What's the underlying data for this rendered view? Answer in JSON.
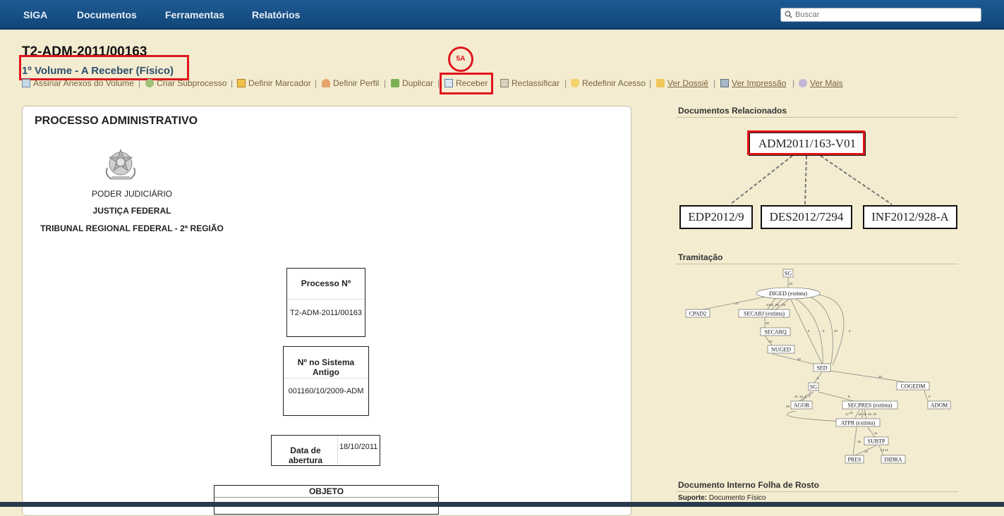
{
  "nav": {
    "items": [
      "SIGA",
      "Documentos",
      "Ferramentas",
      "Relatórios"
    ],
    "search_placeholder": "Buscar"
  },
  "page": {
    "title": "T2-ADM-2011/00163",
    "volume": "1º Volume - A Receber (Físico)",
    "annotation": "5A"
  },
  "actions": [
    {
      "label": "Assinar Anexos do Volume",
      "icon": "sign-icon"
    },
    {
      "label": "Criar Subprocesso",
      "icon": "subprocess-icon"
    },
    {
      "label": "Definir Marcador",
      "icon": "bookmark-icon"
    },
    {
      "label": "Definir Perfil",
      "icon": "profile-icon"
    },
    {
      "label": "Duplicar",
      "icon": "duplicate-icon"
    },
    {
      "label": "Receber",
      "icon": "receive-icon"
    },
    {
      "label": "Reclassificar",
      "icon": "reclassify-icon"
    },
    {
      "label": "Redefinir Acesso",
      "icon": "shield-icon"
    },
    {
      "label": "Ver Dossiê",
      "icon": "folder-icon"
    },
    {
      "label": "Ver Impressão",
      "icon": "printer-icon"
    },
    {
      "label": "Ver Mais",
      "icon": "eye-icon"
    }
  ],
  "document": {
    "heading": "PROCESSO ADMINISTRATIVO",
    "org_line1": "PODER JUDICIÁRIO",
    "org_line2": "JUSTIÇA FEDERAL",
    "org_line3": "TRIBUNAL REGIONAL FEDERAL - 2ª REGIÃO",
    "processo_label": "Processo Nº",
    "processo_value": "T2-ADM-2011/00163",
    "antigo_label": "Nº no Sistema Antigo",
    "antigo_value": "001160/10/2009-ADM",
    "abertura_label": "Data de abertura",
    "abertura_value": "18/10/2011",
    "objeto_label": "OBJETO"
  },
  "sidebar": {
    "related_title": "Documentos Relacionados",
    "related_root": "ADM2011/163-V01",
    "related_children": [
      "EDP2012/9",
      "DES2012/7294",
      "INF2012/928-A"
    ],
    "tramitacao_title": "Tramitação",
    "folha_title": "Documento Interno Folha de Rosto",
    "suporte_label": "Suporte:",
    "suporte_value": "Documento Físico"
  },
  "tramitacao": {
    "nodes": [
      "SG",
      "DIGED (extinta)",
      "CPAD2",
      "SECARJ (extinta)",
      "SECARQ",
      "NUGED",
      "SED",
      "SG",
      "COGEDM",
      "AGOR",
      "SECPRES (extinta)",
      "ADOM",
      "ATPR (extinta)",
      "SUBTP",
      "PRES",
      "DIDRA"
    ],
    "edge_labels": [
      "23",
      "27",
      "24",
      "25",
      "29",
      "28",
      "30",
      "31",
      "32",
      "3",
      "5",
      "34",
      "4",
      "6",
      "33",
      "21",
      "12",
      "1",
      "7",
      "26",
      "8",
      "9",
      "22",
      "17",
      "18",
      "10",
      "16",
      "19",
      "11",
      "15",
      "14",
      "13",
      "12"
    ]
  },
  "colors": {
    "navbar": "#1d5a93",
    "background": "#f4ecd0",
    "annotation_red": "#e0161d",
    "link_blue": "#2c4f6c"
  }
}
